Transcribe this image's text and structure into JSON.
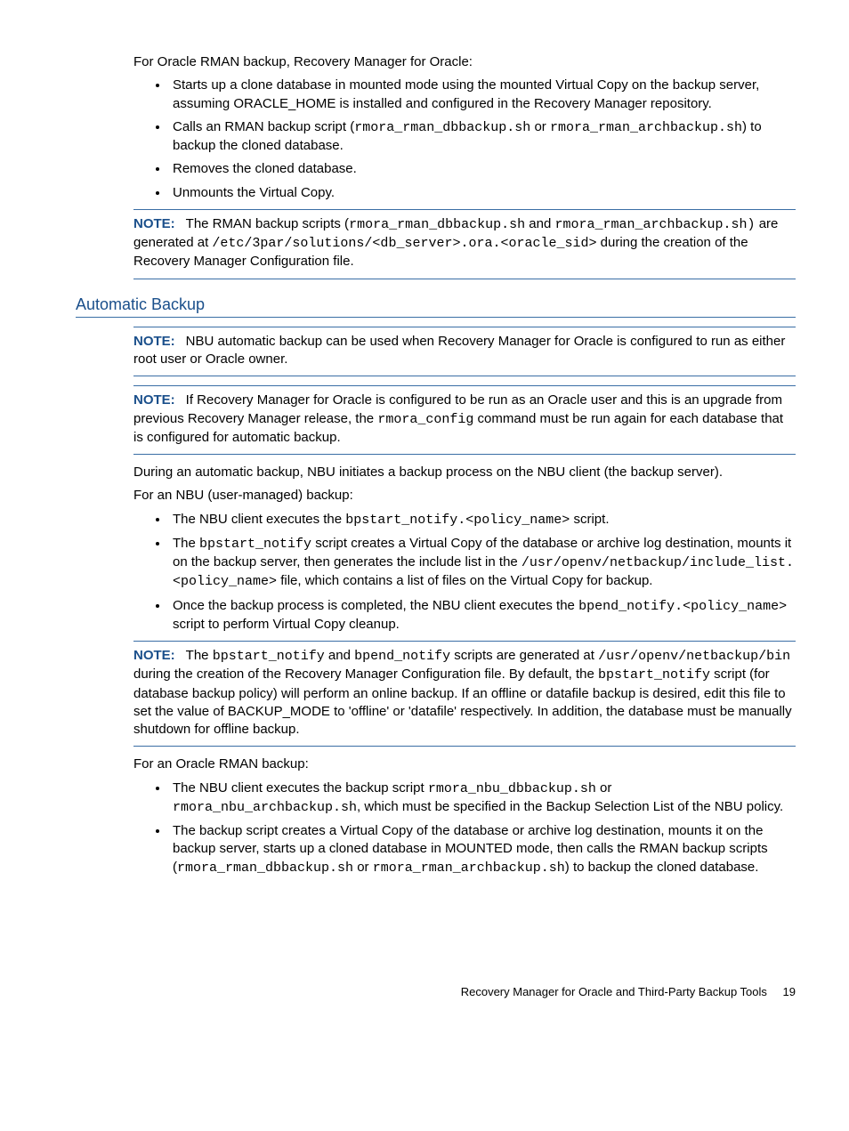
{
  "intro": "For Oracle RMAN backup, Recovery Manager for Oracle:",
  "bullets1": {
    "b1": "Starts up a clone database in mounted mode using the mounted Virtual Copy on the backup server, assuming ORACLE_HOME is installed and configured in the Recovery Manager repository.",
    "b2_pre": "Calls an RMAN backup script (",
    "b2_c1": "rmora_rman_dbbackup.sh",
    "b2_mid": " or ",
    "b2_c2": "rmora_rman_archbackup.sh",
    "b2_post": ") to backup the cloned database.",
    "b3": "Removes the cloned database.",
    "b4": "Unmounts the Virtual Copy."
  },
  "note1": {
    "label": "NOTE:",
    "t1": "The RMAN backup scripts (",
    "c1": "rmora_rman_dbbackup.sh",
    "t2": " and ",
    "c2": "rmora_rman_archbackup.sh)",
    "t3": " are generated at ",
    "c3": "/etc/3par/solutions/<db_server>.ora.<oracle_sid>",
    "t4": " during the creation of the Recovery Manager Configuration file."
  },
  "heading": "Automatic Backup",
  "note2": {
    "label": "NOTE:",
    "t1": "NBU automatic backup can be used when Recovery Manager for Oracle is configured to run as either root user or Oracle owner."
  },
  "note3": {
    "label": "NOTE:",
    "t1": "If Recovery Manager for Oracle is configured to be run as an Oracle user and this is an upgrade from previous Recovery Manager release, the ",
    "c1": "rmora_config",
    "t2": " command must be run again for each database that is configured for automatic backup."
  },
  "para2": "During an automatic backup, NBU initiates a backup process on the NBU client (the backup server).",
  "para3": "For an NBU (user-managed) backup:",
  "bullets2": {
    "b1_pre": "The NBU client executes the ",
    "b1_c1": "bpstart_notify.<policy_name>",
    "b1_post": " script.",
    "b2_pre": "The ",
    "b2_c1": "bpstart_notify",
    "b2_mid": " script creates a Virtual Copy of the database or archive log destination, mounts it on the backup server, then generates the include list in the ",
    "b2_c2": "/usr/openv/netbackup/include_list.<policy_name>",
    "b2_post": " file, which contains a list of files on the Virtual Copy for backup.",
    "b3_pre": "Once the backup process is completed, the NBU client executes the ",
    "b3_c1": "bpend_notify.<policy_name>",
    "b3_post": " script to perform Virtual Copy cleanup."
  },
  "note4": {
    "label": "NOTE:",
    "t1": "The ",
    "c1": "bpstart_notify",
    "t2": " and ",
    "c2": "bpend_notify",
    "t3": " scripts are generated at ",
    "c3": "/usr/openv/netbackup/bin",
    "t4": " during the creation of the Recovery Manager Configuration file. By default, the ",
    "c4": "bpstart_notify",
    "t5": " script (for database backup policy) will perform an online backup. If an offline or datafile backup is desired, edit this file to set the value of BACKUP_MODE to 'offline' or 'datafile' respectively. In addition, the database must be manually shutdown for offline backup."
  },
  "para4": "For an Oracle RMAN backup:",
  "bullets3": {
    "b1_pre": "The NBU client executes the backup script ",
    "b1_c1": "rmora_nbu_dbbackup.sh",
    "b1_mid": " or ",
    "b1_c2": "rmora_nbu_archbackup.sh",
    "b1_post": ", which must be specified in the Backup Selection List of the NBU policy.",
    "b2_pre": "The backup script creates a Virtual Copy of the database or archive log destination, mounts it on the backup server, starts up a cloned database in MOUNTED mode, then calls the RMAN backup scripts (",
    "b2_c1": "rmora_rman_dbbackup.sh",
    "b2_mid": " or ",
    "b2_c2": "rmora_rman_archbackup.sh",
    "b2_post": ") to backup the cloned database."
  },
  "footer": {
    "text": "Recovery Manager for Oracle and Third-Party Backup Tools",
    "page": "19"
  }
}
